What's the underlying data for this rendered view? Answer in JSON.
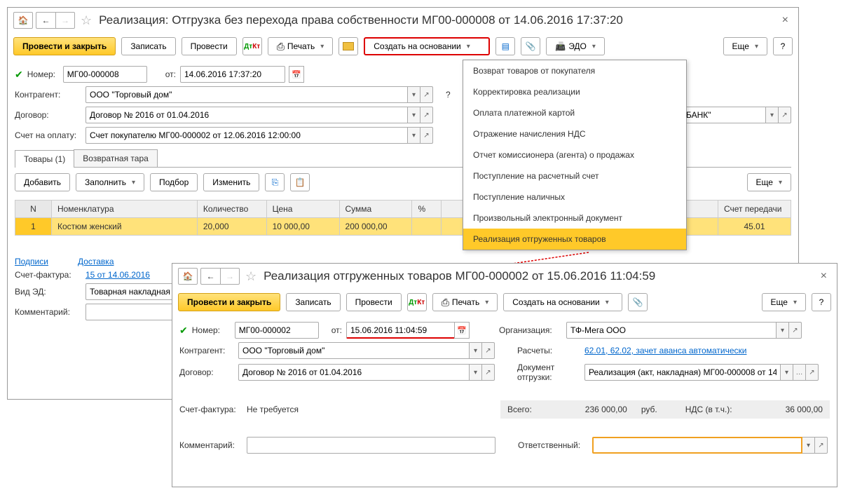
{
  "win1": {
    "title": "Реализация: Отгрузка без перехода права собственности МГ00-000008 от 14.06.2016 17:37:20",
    "toolbar": {
      "post_close": "Провести и закрыть",
      "save": "Записать",
      "post": "Провести",
      "print": "Печать",
      "create_based": "Создать на основании",
      "edo": "ЭДО",
      "more": "Еще",
      "help": "?"
    },
    "fields": {
      "number_label": "Номер:",
      "number": "МГ00-000008",
      "date_label": "от:",
      "date": "14.06.2016 17:37:20",
      "contractor_label": "Контрагент:",
      "contractor": "ООО \"Торговый дом\"",
      "contract_label": "Договор:",
      "contract": "Договор № 2016 от 01.04.2016",
      "bank_suffix": "БАНК\"",
      "invoice_label": "Счет на оплату:",
      "invoice": "Счет покупателю МГ00-000002 от 12.06.2016 12:00:00"
    },
    "tabs": {
      "goods": "Товары (1)",
      "tare": "Возвратная тара"
    },
    "subtoolbar": {
      "add": "Добавить",
      "fill": "Заполнить",
      "pick": "Подбор",
      "change": "Изменить",
      "more": "Еще"
    },
    "table": {
      "headers": {
        "n": "N",
        "item": "Номенклатура",
        "qty": "Количество",
        "price": "Цена",
        "sum": "Сумма",
        "pct": "%",
        "transfer_acc": "Счет передачи"
      },
      "rows": [
        {
          "n": "1",
          "item": "Костюм женский",
          "qty": "20,000",
          "price": "10 000,00",
          "sum": "200 000,00",
          "transfer_acc": "45.01"
        }
      ]
    },
    "bottom": {
      "signatures": "Подписи",
      "delivery": "Доставка",
      "sf_label": "Счет-фактура:",
      "sf_link": "15 от 14.06.2016",
      "vid_ed_label": "Вид ЭД:",
      "vid_ed": "Товарная накладная",
      "comment_label": "Комментарий:"
    }
  },
  "dropdown": {
    "items": [
      "Возврат товаров от покупателя",
      "Корректировка реализации",
      "Оплата платежной картой",
      "Отражение начисления НДС",
      "Отчет комиссионера (агента) о продажах",
      "Поступление на расчетный счет",
      "Поступление наличных",
      "Произвольный электронный документ",
      "Реализация отгруженных товаров"
    ],
    "highlighted_index": 8
  },
  "win2": {
    "title": "Реализация отгруженных товаров МГ00-000002 от 15.06.2016 11:04:59",
    "toolbar": {
      "post_close": "Провести и закрыть",
      "save": "Записать",
      "post": "Провести",
      "print": "Печать",
      "create_based": "Создать на основании",
      "more": "Еще",
      "help": "?"
    },
    "fields": {
      "number_label": "Номер:",
      "number": "МГ00-000002",
      "date_label": "от:",
      "date": "15.06.2016 11:04:59",
      "org_label": "Организация:",
      "org": "ТФ-Мега ООО",
      "contractor_label": "Контрагент:",
      "contractor": "ООО \"Торговый дом\"",
      "calc_label": "Расчеты:",
      "calc_link": "62.01, 62.02, зачет аванса автоматически",
      "contract_label": "Договор:",
      "contract": "Договор № 2016 от 01.04.2016",
      "shipdoc_label": "Документ отгрузки:",
      "shipdoc": "Реализация (акт, накладная) МГ00-000008 от 14.",
      "sf_label": "Счет-фактура:",
      "sf_value": "Не требуется",
      "comment_label": "Комментарий:",
      "resp_label": "Ответственный:"
    },
    "totals": {
      "total_label": "Всего:",
      "total": "236 000,00",
      "currency": "руб.",
      "vat_label": "НДС (в т.ч.):",
      "vat": "36 000,00"
    }
  }
}
